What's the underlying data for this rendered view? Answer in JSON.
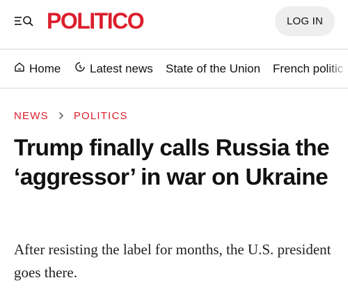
{
  "header": {
    "logo_text": "POLITICO",
    "login_label": "LOG IN",
    "menu_icon": "menu-search-icon",
    "brand_color": "#dc1e2c"
  },
  "nav": {
    "items": [
      {
        "label": "Home",
        "icon": "home-icon"
      },
      {
        "label": "Latest news",
        "icon": "clock-icon"
      },
      {
        "label": "State of the Union"
      },
      {
        "label": "French politic"
      }
    ]
  },
  "article": {
    "breadcrumb": [
      "NEWS",
      "POLITICS"
    ],
    "headline": "Trump finally calls Russia the ‘aggressor’ in war on Ukraine",
    "dek": "After resisting the label for months, the U.S. president goes there."
  }
}
